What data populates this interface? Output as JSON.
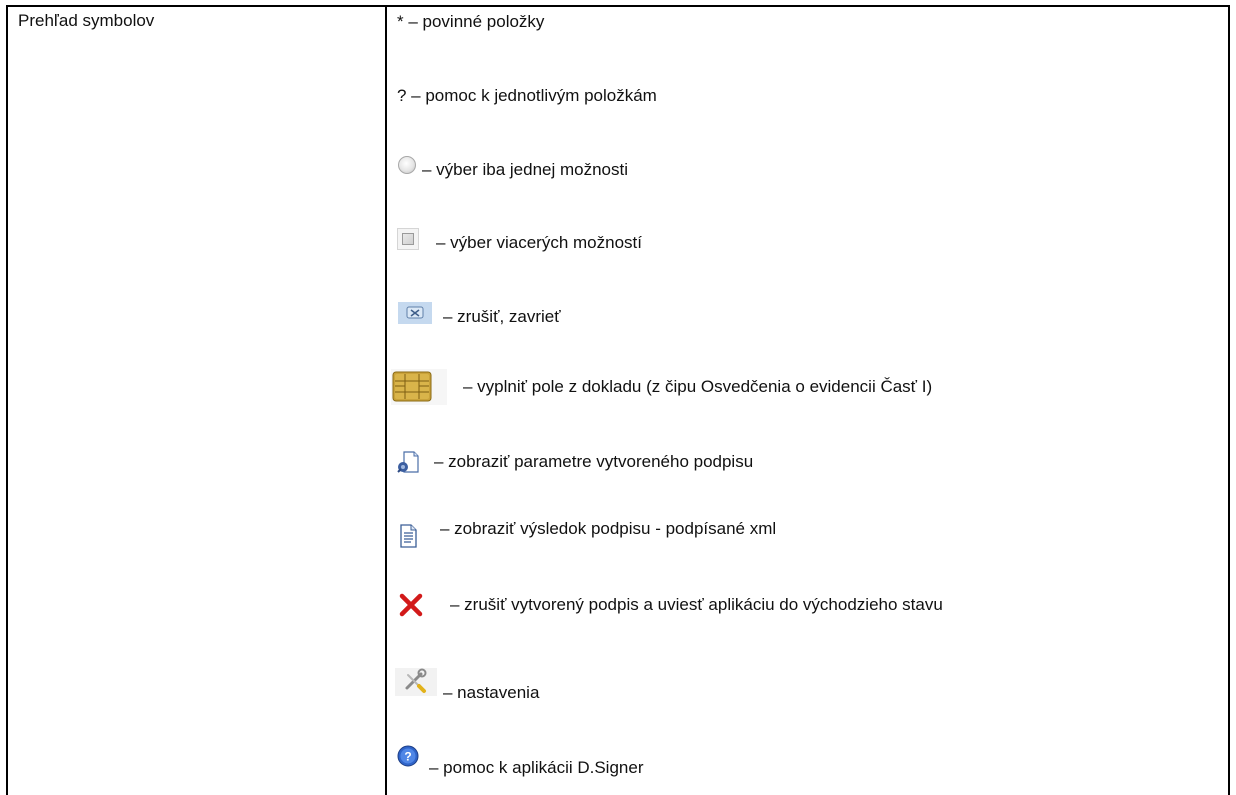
{
  "table": {
    "left_label": "Prehľad symbolov",
    "rows": [
      {
        "text": "* – povinné položky",
        "icon": "none"
      },
      {
        "text": "? – pomoc k jednotlivým položkám",
        "icon": "none"
      },
      {
        "text": "– výber iba jednej možnosti",
        "icon": "radio-button-icon"
      },
      {
        "text": "– výber viacerých možností",
        "icon": "checkbox-icon"
      },
      {
        "text": "– zrušiť, zavrieť",
        "icon": "close-box-icon"
      },
      {
        "text": "– vyplniť pole z dokladu (z čipu Osvedčenia o evidencii Časť I)",
        "icon": "smart-chip-icon"
      },
      {
        "text": "– zobraziť parametre vytvoreného podpisu",
        "icon": "signature-params-icon"
      },
      {
        "text": "– zobraziť výsledok podpisu - podpísané xml",
        "icon": "document-icon"
      },
      {
        "text": "– zrušiť vytvorený podpis a uviesť aplikáciu do východzieho stavu",
        "icon": "red-x-icon"
      },
      {
        "text": "– nastavenia",
        "icon": "tools-icon"
      },
      {
        "text": "– pomoc k aplikácii D.Signer",
        "icon": "help-icon"
      }
    ]
  }
}
